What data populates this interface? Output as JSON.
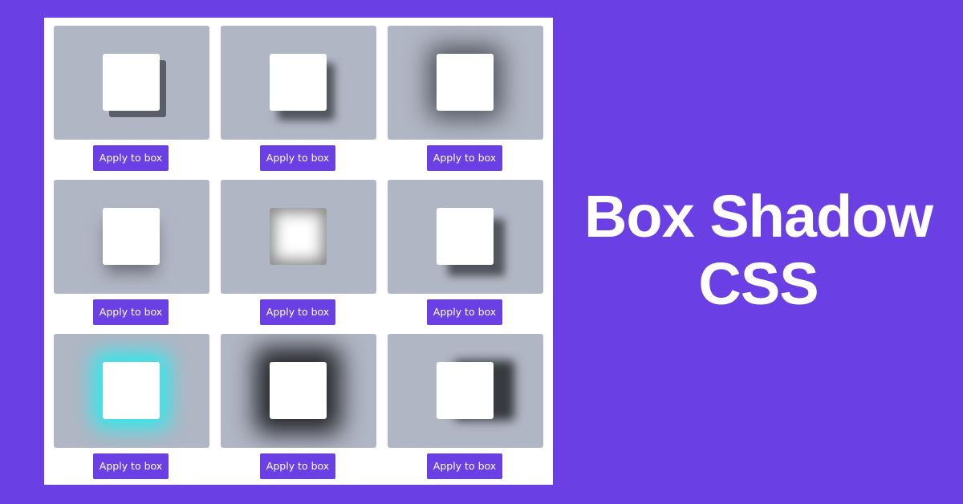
{
  "headline": {
    "line1": "Box Shadow",
    "line2": "CSS"
  },
  "colors": {
    "background": "#6a3fe4",
    "panel": "#ffffff",
    "card": "#b1b6c4",
    "button": "#6a3fe4",
    "glow": "#2fe9ec"
  },
  "examples": [
    {
      "variant": "hard-offset-shadow",
      "button_label": "Apply to box"
    },
    {
      "variant": "soft-offset-shadow",
      "button_label": "Apply to box"
    },
    {
      "variant": "spread-blur-shadow",
      "button_label": "Apply to box"
    },
    {
      "variant": "bottom-shadow",
      "button_label": "Apply to box"
    },
    {
      "variant": "inset-shadow",
      "button_label": "Apply to box"
    },
    {
      "variant": "large-offset-shadow",
      "button_label": "Apply to box"
    },
    {
      "variant": "cyan-glow-shadow",
      "button_label": "Apply to box"
    },
    {
      "variant": "dark-spread-shadow",
      "button_label": "Apply to box"
    },
    {
      "variant": "right-shadow",
      "button_label": "Apply to box"
    }
  ]
}
